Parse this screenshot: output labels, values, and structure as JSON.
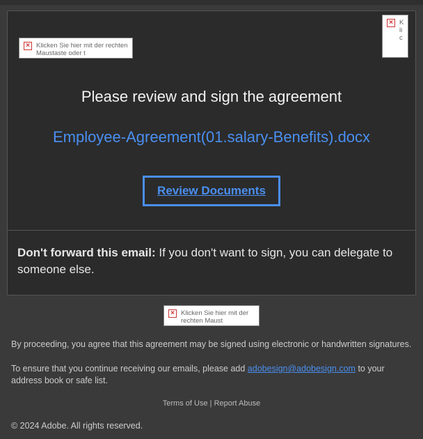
{
  "broken_img_text": "Klicken Sie hier mit der rechten Maustaste oder t",
  "broken_img_text_short": "Klic",
  "broken_img_text_mid": "Klicken Sie hier mit der rechten Maust",
  "headline": "Please review and sign the agreement",
  "filename": "Employee-Agreement(01.salary-Benefits).docx",
  "review_button": "Review Documents",
  "forward": {
    "bold": "Don't forward this email:",
    "rest": " If you don't want to sign, you can delegate to someone else."
  },
  "footer": {
    "proceed": "By proceeding, you agree that this agreement may be signed using electronic or handwritten signatures.",
    "ensure_pre": "To ensure that you continue receiving our emails, please add ",
    "email": "adobesign@adobesign.com",
    "ensure_post": " to your address book or safe list.",
    "terms": "Terms of Use",
    "sep": " | ",
    "report": "Report Abuse",
    "copyright": "© 2024 Adobe. All rights reserved."
  }
}
